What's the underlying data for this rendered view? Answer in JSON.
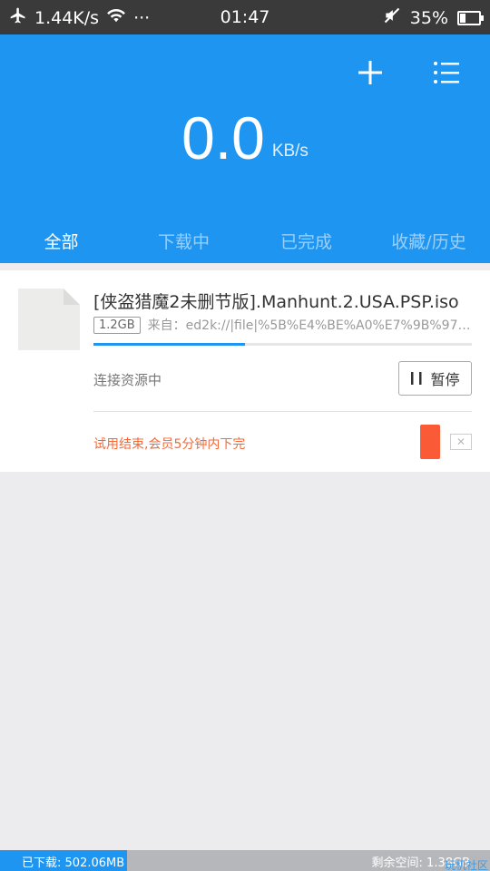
{
  "status_bar": {
    "network_speed": "1.44K/s",
    "more": "···",
    "time": "01:47",
    "battery": "35%",
    "battery_level": 0.35
  },
  "header": {
    "speed_value": "0.0",
    "speed_unit": "KB/s",
    "tabs": [
      {
        "label": "全部",
        "active": true
      },
      {
        "label": "下载中",
        "active": false
      },
      {
        "label": "已完成",
        "active": false
      },
      {
        "label": "收藏/历史",
        "active": false
      }
    ],
    "accent_color": "#1f95f2"
  },
  "download": {
    "file_name": "[侠盗猎魔2未删节版].Manhunt.2.USA.PSP.iso",
    "size": "1.2GB",
    "source": "来自：ed2k://|file|%5B%E4%BE%A0%E7%9B%97%E7…",
    "progress": 0.4,
    "status": "连接资源中",
    "pause_label": "暂停",
    "trial_notice": "试用结束,会员5分钟内下完"
  },
  "storage": {
    "downloaded": "已下载: 502.06MB",
    "remaining": "剩余空间: 1.38GB",
    "used_fraction": 0.26
  },
  "watermark": "玩机社区"
}
